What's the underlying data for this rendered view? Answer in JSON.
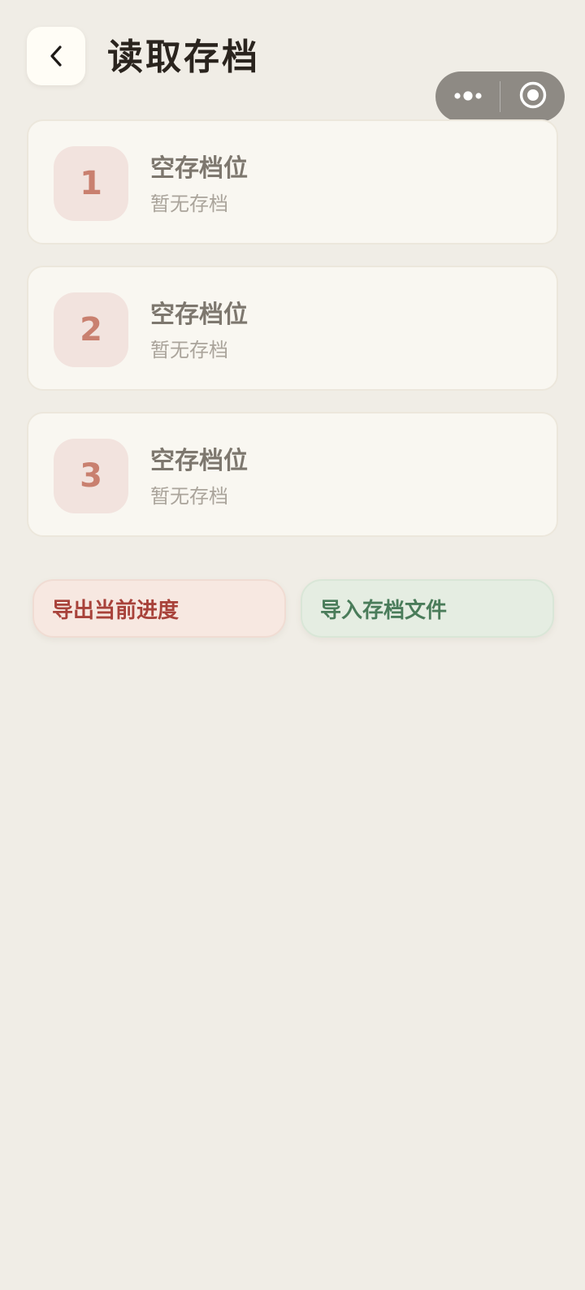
{
  "header": {
    "title": "读取存档"
  },
  "capsule": {
    "more_icon": "more-dots-icon",
    "close_icon": "record-circle-icon"
  },
  "slots": [
    {
      "number": "1",
      "title": "空存档位",
      "subtitle": "暂无存档"
    },
    {
      "number": "2",
      "title": "空存档位",
      "subtitle": "暂无存档"
    },
    {
      "number": "3",
      "title": "空存档位",
      "subtitle": "暂无存档"
    }
  ],
  "actions": {
    "export_label": "导出当前进度",
    "import_label": "导入存档文件"
  },
  "colors": {
    "background": "#f0ede6",
    "card": "#f9f7f1",
    "slot_badge": "#f2e3de",
    "slot_number": "#c9806f",
    "export_text": "#a8423a",
    "import_text": "#4a7c5a"
  }
}
